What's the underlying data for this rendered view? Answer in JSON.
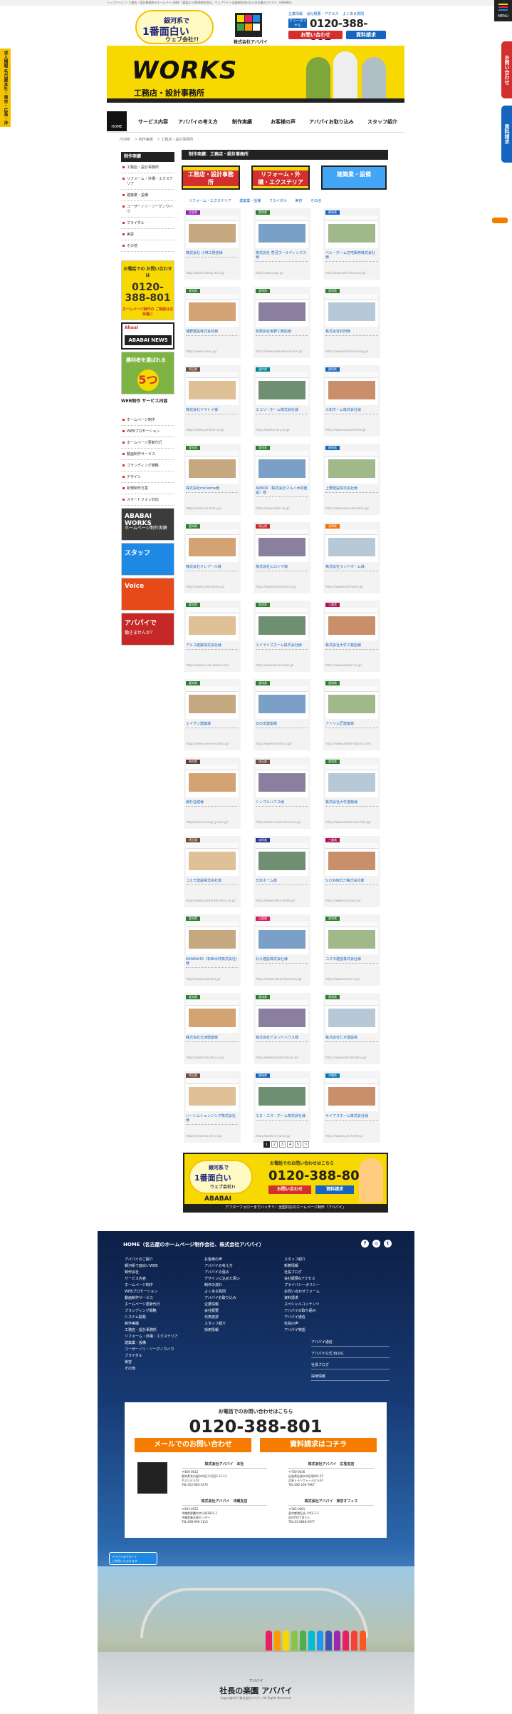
{
  "top_bar": "トップページ ＞ 工務店・設計事務所のホームページ制作・愛媛ならWEB制作会社。ウェブサイト企画制作会社なら名古屋のアバパイ（ABABAI）",
  "header": {
    "logo_line1": "銀河系で",
    "logo_line2": "1番面白い",
    "logo_line3": "ウェブ会社!!",
    "company": "株式会社アバパイ",
    "nav": [
      "企業情報",
      "会社概要・アクセス",
      "よくある質問"
    ],
    "tel_tag": "フリーダイヤル",
    "tel": "0120-388-801",
    "contact_btn": "お問い合わせ",
    "request_btn": "資料請求",
    "menu": "MENU"
  },
  "side": {
    "left": "求人情報 名古屋本社・東京・広島・沖縄支社",
    "right1": "お問い合わせ",
    "right2": "資料請求"
  },
  "banner": {
    "title": "WORKS",
    "subtitle": "工務店・設計事務所"
  },
  "gnav": {
    "home": "HOME",
    "items": [
      "サービス内容",
      "アバパイの考え方",
      "制作実績",
      "お客様の声",
      "アバパイお取り込み",
      "スタッフ紹介"
    ]
  },
  "breadcrumb": [
    "HOME",
    "制作実績",
    "工務店・設計事務所"
  ],
  "sidebar": {
    "head": "制作実績",
    "items": [
      "工務店・設計事務所",
      "リフォーム・外構・エクステリア",
      "建築業・設備",
      "ユーザーノリ・リーグノウハウ",
      "ブライダル",
      "美容",
      "その他"
    ],
    "tel_title": "お電話での\nお問い合わせは",
    "tel_num": "0120-\n388-801",
    "tel_note": "ホームページ制作の\nご相談はお気軽に",
    "news_title": "Ahaa!",
    "news_label": "ABABAI NEWS",
    "five_title": "勝利者を選ばれる",
    "five_num": "5つ",
    "service_head": "WEB制作\nサービス内容",
    "service_items": [
      "ホームページ制作",
      "WEBプロモーション",
      "ホームページ更新代行",
      "動画制作サービス",
      "ブランディング戦略",
      "デザイン",
      "新規制作方案",
      "スマートフォン対応"
    ],
    "img1_t1": "ABABAI WORKS",
    "img1_t2": "ホームページ制作実績",
    "img2_t1": "スタッフ",
    "img2_t2": "",
    "img3_t1": "Voice",
    "img3_t2": "",
    "img4_t1": "アバパイで",
    "img4_t2": "働きませんか？"
  },
  "main": {
    "title": "制作実績：工務店・設計事務所",
    "cats": [
      "工務店・設計事務所",
      "リフォーム・外構・エクステリア",
      "建築業・設備"
    ],
    "tags": [
      "リフォーム・エクステリア",
      "建築業・設備",
      "ブライダル",
      "美容",
      "その他"
    ],
    "cards": [
      {
        "pref": "広島県",
        "name": "株式会社 小林工務店様",
        "url": "http://www.k-kobay ashi.jp/"
      },
      {
        "pref": "愛知県",
        "name": "株式会社 菅沼ホールディングス様",
        "url": "http://www.sugn.jp/"
      },
      {
        "pref": "静岡県",
        "name": "ベル・ホーム住宅販売株式会社様",
        "url": "http://www.bele-home.co.jp/"
      },
      {
        "pref": "愛知県",
        "name": "浦野建設株式会社様",
        "url": "https://www.urano.jp/"
      },
      {
        "pref": "愛知県",
        "name": "有限会社坂野工務店様",
        "url": "https://www.sakanokoumuten.jp/"
      },
      {
        "pref": "愛知県",
        "name": "株式会社石田様",
        "url": "https://www.ishida-housing.jp/"
      },
      {
        "pref": "埼玉県",
        "name": "株式会社ヤマトイ様",
        "url": "https://www.yamatoi.co.jp/"
      },
      {
        "pref": "福井県",
        "name": "エコリーホーム株式会社様",
        "url": "https://www.ecory.co.jp/"
      },
      {
        "pref": "静岡県",
        "name": "三和ホーム株式会社様",
        "url": "https://www.sanwa-home.jp/"
      },
      {
        "pref": "愛知県",
        "name": "株式会社mkhome様",
        "url": "https://www.mk-home.jp/"
      },
      {
        "pref": "愛知県",
        "name": "ARBOR（株式会社マルハ木材建設）様",
        "url": "https://www.arbor.co.jp/"
      },
      {
        "pref": "静岡県",
        "name": "上野建設株式会社様",
        "url": "https://www.ueno-kensetsu.jp/"
      },
      {
        "pref": "愛知県",
        "name": "株式会社クレアール様",
        "url": "https://www.creer-home.jp/"
      },
      {
        "pref": "岡山県",
        "name": "株式会社ヒロシマ様",
        "url": "https://www.hiroshima.co.jp/"
      },
      {
        "pref": "長崎県",
        "name": "株式会社ランドホーム様",
        "url": "https://www.land-home.jp/"
      },
      {
        "pref": "愛知県",
        "name": "アルコ建築株式会社様",
        "url": "https://www.aruko-home.com/"
      },
      {
        "pref": "愛知県",
        "name": "エイライズホーム株式会社様",
        "url": "https://www.arise-home.jp/"
      },
      {
        "pref": "三重県",
        "name": "株式会社大竹工務店様",
        "url": "https://www.ootake.co.jp/"
      },
      {
        "pref": "愛知県",
        "name": "エイヴン建築様",
        "url": "https://www.aven-kenchiku.jp/"
      },
      {
        "pref": "愛知県",
        "name": "日の出建築様",
        "url": "https://www.hinode.co.jp/"
      },
      {
        "pref": "愛知県",
        "name": "アトリエ匠建築様",
        "url": "https://www.atelier-takumi.com/"
      },
      {
        "pref": "奈良県",
        "name": "美杉住建様",
        "url": "https://www.misugi-jyuken.jp/"
      },
      {
        "pref": "埼玉県",
        "name": "シンプルハウス様",
        "url": "https://www.simple-house.co.jp/"
      },
      {
        "pref": "愛知県",
        "name": "株式会社大竹建築様",
        "url": "https://www.ootake-kenchiku.jp/"
      },
      {
        "pref": "埼玉県",
        "name": "コスモ建設株式会社様",
        "url": "https://www.cosmo-kensetsu.co.jp/"
      },
      {
        "pref": "岐阜県",
        "name": "日本ホーム様",
        "url": "https://www.nihon-home.jp/"
      },
      {
        "pref": "三重県",
        "name": "S.CONNECT株式会社様",
        "url": "https://www.sconnect.jp/"
      },
      {
        "pref": "愛知県",
        "name": "AKANAHO（石田木材株式会社）様",
        "url": "https://www.akanaho.jp/"
      },
      {
        "pref": "山梨県",
        "name": "北斗建設株式会社様",
        "url": "https://www.hokuto-kensetsu.jp/"
      },
      {
        "pref": "愛知県",
        "name": "コスモ建設株式会社様",
        "url": "https://www.cosmo-k.jp/"
      },
      {
        "pref": "愛知県",
        "name": "株式会社北洲建築様",
        "url": "https://www.hokushu.co.jp/"
      },
      {
        "pref": "愛知県",
        "name": "株式会社ビヨンドハウス様",
        "url": "https://www.beyond-house.jp/"
      },
      {
        "pref": "愛知県",
        "name": "株式会社仁木建設様",
        "url": "https://www.niki-kensetsu.jp/"
      },
      {
        "pref": "埼玉県",
        "name": "ハーシムシェンジング株式会社様",
        "url": "https://www.harsim.co.jp/"
      },
      {
        "pref": "静岡県",
        "name": "エヌ・エス・ホーム株式会社様",
        "url": "https://www.ns-home.jp/"
      },
      {
        "pref": "沖縄県",
        "name": "サイアスホーム株式会社様",
        "url": "https://www.cyas-home.jp/"
      }
    ],
    "pages": [
      "1",
      "2",
      "3",
      "4",
      "5",
      "＞"
    ]
  },
  "cta": {
    "logo_line1": "銀河系で",
    "logo_line2": "1番面白い",
    "logo_line3": "ウェブ会社!!",
    "brand": "ABABAI",
    "question": "お電話でのお問い合わせはこちら",
    "tel": "0120-388-801",
    "btn1": "お問い合わせ",
    "btn2": "資料請求",
    "footer": "アフターフォローまでバッチリ！全国対応のホームページ制作「アバパイ」"
  },
  "footer": {
    "home": "HOME（名古屋のホームページ制作会社、株式会社アバパイ）",
    "social": [
      "f",
      "◎",
      "t"
    ],
    "col1": [
      "アバパイのご紹介",
      "銀河系で面白いWEB",
      "制作会社",
      "サービス内容",
      "ホームページ制作",
      "WEBプロモーション",
      "動画制作サービス",
      "ホームページ更新代行",
      "ブランディング戦略",
      "システム開発",
      "制作実績",
      "工務店・設計事務所",
      "リフォーム・外構・エクステリア",
      "建築業・設備",
      "ユーザーノリ・リーグノウハウ",
      "ブライダル",
      "美容",
      "その他"
    ],
    "col2": [
      "お客様の声",
      "アバパイの考え方",
      "アバパイの強み",
      "デザインに込めた思い",
      "制作の流れ",
      "よくある質問",
      "アバパイお取り込み",
      "企業情報",
      "会社概要",
      "代表挨拶",
      "スタッフ紹介",
      "採用情報"
    ],
    "col3": [
      "スタッフ紹介",
      "新着情報",
      "社長ブログ",
      "会社概要&アクセス",
      "プライバシーポリシー",
      "お問い合わせフォーム",
      "資料請求",
      "スペシャルコンテンツ",
      "アバパイの取り組み",
      "アバパイ通信",
      "社員の声",
      "アバパイ物語"
    ],
    "side_links": [
      "アバパイ通信",
      "アバパイ公式 BLOG",
      "社長ブログ",
      "採用情報"
    ],
    "box_question": "お電話でのお問い合わせはこちら",
    "box_tel": "0120-388-801",
    "mail_btn": "メールでのお問い合わせ",
    "request_btn": "資料請求はコチラ",
    "offices": [
      {
        "name": "株式会社アバパイ　本社",
        "addr": "〒460-0012\n愛知県名古屋市中区千代田3-11-11\nやよいビル5F\nTEL:052-684-4270"
      },
      {
        "name": "株式会社アバパイ　広島支店",
        "addr": "〒730-0036\n広島県広島市中区袋町5-25\n広島トランヴェールビル3F\nTEL:082-236-7667"
      },
      {
        "name": "株式会社アバパイ　沖縄支店",
        "addr": "〒901-0152\n沖縄県那覇市字小禄1831-1\n沖縄産業支援センター\nTEL:098-996-1115"
      },
      {
        "name": "株式会社アバパイ　東京オフィス",
        "addr": "〒105-0001\n東京都港区虎ノ門3-1-1\n虎の門3丁目ビル\nTEL:03-6848-6977"
      }
    ],
    "badge": "アバパイのサポート\nご利用いただけます",
    "kana": "アバパイ",
    "title": "社長の楽園 アバパイ",
    "copyright": "Copyright(C) 株式会社アバパイ All Rights Reserved."
  }
}
